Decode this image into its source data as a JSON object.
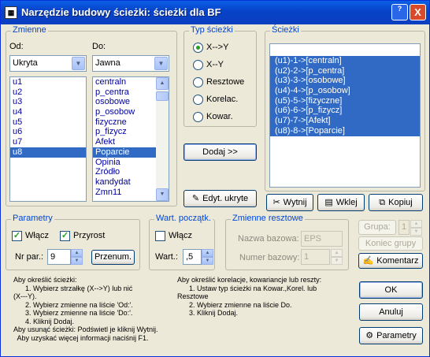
{
  "window": {
    "title": "Narzędzie budowy ścieżki: ścieżki dla BF",
    "help_btn": "?",
    "close_btn": "X"
  },
  "zmienne": {
    "legend": "Zmienne",
    "from_label": "Od:",
    "to_label": "Do:",
    "from_filter": "Ukryta",
    "to_filter": "Jawna",
    "from_items": [
      "u1",
      "u2",
      "u3",
      "u4",
      "u5",
      "u6",
      "u7",
      "u8"
    ],
    "from_selected": "u8",
    "to_items": [
      "centraln",
      "p_centra",
      "osobowe",
      "p_osobow",
      "fizyczne",
      "p_fizycz",
      "Afekt",
      "Poparcie",
      "Opinia",
      "Zródło",
      "kandydat",
      "Zmn11"
    ],
    "to_selected": "Poparcie"
  },
  "typ": {
    "legend": "Typ ścieżki",
    "options": [
      "X-->Y",
      "X--Y",
      "Resztowe",
      "Korelac.",
      "Kowar."
    ],
    "selected": "X-->Y"
  },
  "dodaj_btn": "Dodaj >>",
  "edyt_btn": "Edyt. ukryte",
  "sciezki": {
    "legend": "Ścieżki",
    "items": [
      "(u1)-1->[centraln]",
      "(u2)-2->[p_centra]",
      "(u3)-3->[osobowe]",
      "(u4)-4->[p_osobow]",
      "(u5)-5->[fizyczne]",
      "(u6)-6->[p_fizycz]",
      "(u7)-7->[Afekt]",
      "(u8)-8->[Poparcie]"
    ]
  },
  "edit_buttons": {
    "cut": "Wytnij",
    "paste": "Wklej",
    "copy": "Kopiuj"
  },
  "parametry": {
    "legend": "Parametry",
    "wlacz": "Włącz",
    "wlacz_checked": true,
    "przyrost": "Przyrost",
    "przyrost_checked": true,
    "nr_label": "Nr par.:",
    "nr_value": "9",
    "przenum": "Przenum."
  },
  "wart": {
    "legend": "Wart. początk.",
    "wlacz": "Włącz",
    "wlacz_checked": false,
    "label": "Wart.:",
    "value": ",5"
  },
  "resztowe": {
    "legend": "Zmienne resztowe",
    "nazwa_label": "Nazwa bazowa:",
    "nazwa_value": "EPS",
    "numer_label": "Numer bazowy:",
    "numer_value": "1"
  },
  "grupa": {
    "label": "Grupa:",
    "value": "1",
    "koniec": "Koniec grupy"
  },
  "komentarz": "Komentarz",
  "help_left": [
    "Aby określić ścieżki:",
    "      1. Wybierz strzałkę (X-->Y) lub nić",
    "(X---Y).",
    "      2. Wybierz zmienne na liście 'Od:'.",
    "      3. Wybierz zmienne na liście 'Do:'.",
    "      4. Kliknij Dodaj.",
    "Aby usunąć ścieżki: Podświetl je kliknij Wytnij.",
    "  Aby uzyskać więcej informacji naciśnij F1."
  ],
  "help_right": [
    "Aby określić korelacje, kowariancje lub reszty:",
    "      1. Ustaw typ ścieżki na Kowar.,Korel. lub",
    "Resztowe",
    "      2. Wybierz zmienne na liście Do.",
    "      3. Kliknij Dodaj."
  ],
  "bottom_buttons": {
    "ok": "OK",
    "anuluj": "Anuluj",
    "parametry": "Parametry"
  },
  "colors": {
    "selection": "#316ac5",
    "titlebar": "#0842c8",
    "legend": "#0046d5"
  }
}
